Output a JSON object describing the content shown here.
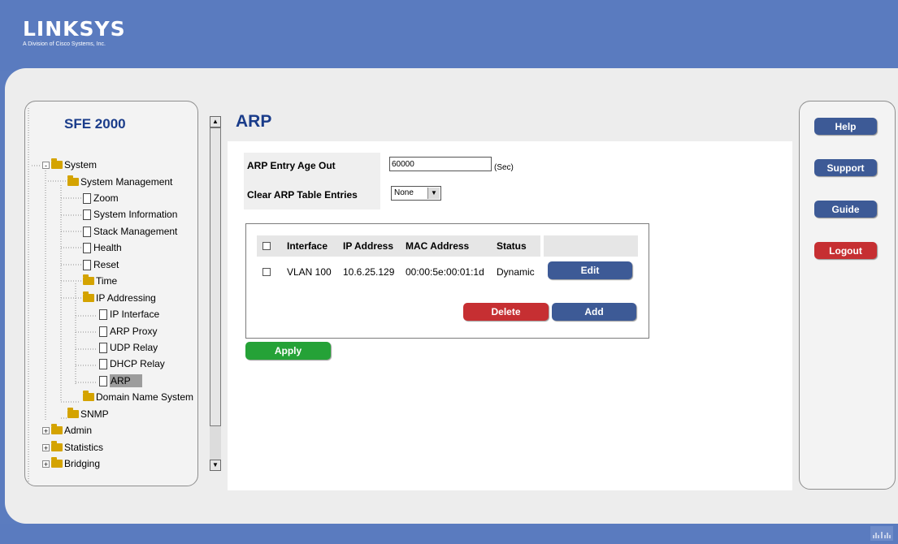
{
  "brand": {
    "name": "LINKSYS",
    "tagline": "A Division of Cisco Systems, Inc."
  },
  "device": {
    "name": "SFE 2000"
  },
  "nav": {
    "items": [
      {
        "label": "System",
        "type": "folder",
        "expander": "-"
      },
      {
        "label": "System Management",
        "type": "folder"
      },
      {
        "label": "Zoom",
        "type": "page"
      },
      {
        "label": "System Information",
        "type": "page"
      },
      {
        "label": "Stack Management",
        "type": "page"
      },
      {
        "label": "Health",
        "type": "page"
      },
      {
        "label": "Reset",
        "type": "page"
      },
      {
        "label": "Time",
        "type": "folder"
      },
      {
        "label": "IP Addressing",
        "type": "folder"
      },
      {
        "label": "IP Interface",
        "type": "page"
      },
      {
        "label": "ARP Proxy",
        "type": "page"
      },
      {
        "label": "UDP Relay",
        "type": "page"
      },
      {
        "label": "DHCP Relay",
        "type": "page"
      },
      {
        "label": "ARP",
        "type": "page",
        "selected": true
      },
      {
        "label": "Domain Name System",
        "type": "folder"
      },
      {
        "label": "SNMP",
        "type": "folder"
      },
      {
        "label": "Admin",
        "type": "folder",
        "expander": "+"
      },
      {
        "label": "Statistics",
        "type": "folder",
        "expander": "+"
      },
      {
        "label": "Bridging",
        "type": "folder",
        "expander": "+"
      }
    ]
  },
  "page": {
    "title": "ARP",
    "age_out_label": "ARP Entry Age Out",
    "age_out_value": "60000",
    "age_out_unit": "(Sec)",
    "clear_label": "Clear ARP Table Entries",
    "clear_value": "None"
  },
  "table": {
    "columns": [
      "Interface",
      "IP Address",
      "MAC Address",
      "Status"
    ],
    "rows": [
      {
        "interface": "VLAN 100",
        "ip": "10.6.25.129",
        "mac": "00:00:5e:00:01:1d",
        "status": "Dynamic"
      }
    ],
    "edit_label": "Edit",
    "delete_label": "Delete",
    "add_label": "Add"
  },
  "apply_label": "Apply",
  "side": {
    "help": "Help",
    "support": "Support",
    "guide": "Guide",
    "logout": "Logout"
  },
  "colors": {
    "header_blue": "#5a7bbf",
    "title_blue": "#1a3c8a",
    "button_navy": "#3d5a96",
    "button_red": "#c62f32",
    "button_green": "#25a237"
  }
}
